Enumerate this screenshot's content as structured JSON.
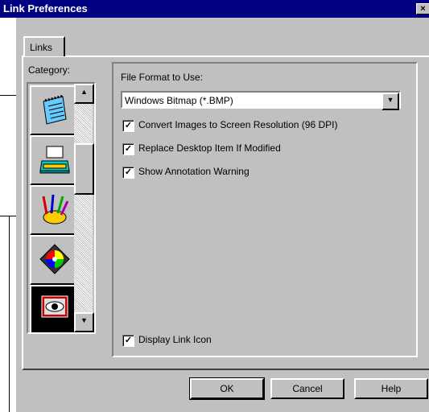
{
  "window": {
    "title": "Link Preferences",
    "close": "×"
  },
  "tabs": [
    {
      "label": "Links"
    }
  ],
  "category": {
    "label": "Category:",
    "items": [
      {
        "icon": "notepad-icon"
      },
      {
        "icon": "typewriter-icon"
      },
      {
        "icon": "art-supplies-icon"
      },
      {
        "icon": "color-wheel-icon"
      },
      {
        "icon": "eye-icon",
        "selected": true
      }
    ]
  },
  "file_format": {
    "label": "File Format to Use:",
    "value": "Windows Bitmap (*.BMP)"
  },
  "options": [
    {
      "label": "Convert Images to Screen Resolution (96 DPI)",
      "checked": true
    },
    {
      "label": "Replace Desktop Item If Modified",
      "checked": true
    },
    {
      "label": "Show Annotation Warning",
      "checked": true
    }
  ],
  "display_link_icon": {
    "label": "Display Link Icon",
    "checked": true
  },
  "buttons": {
    "ok": "OK",
    "cancel": "Cancel",
    "help": "Help"
  },
  "check_glyph": "✓"
}
